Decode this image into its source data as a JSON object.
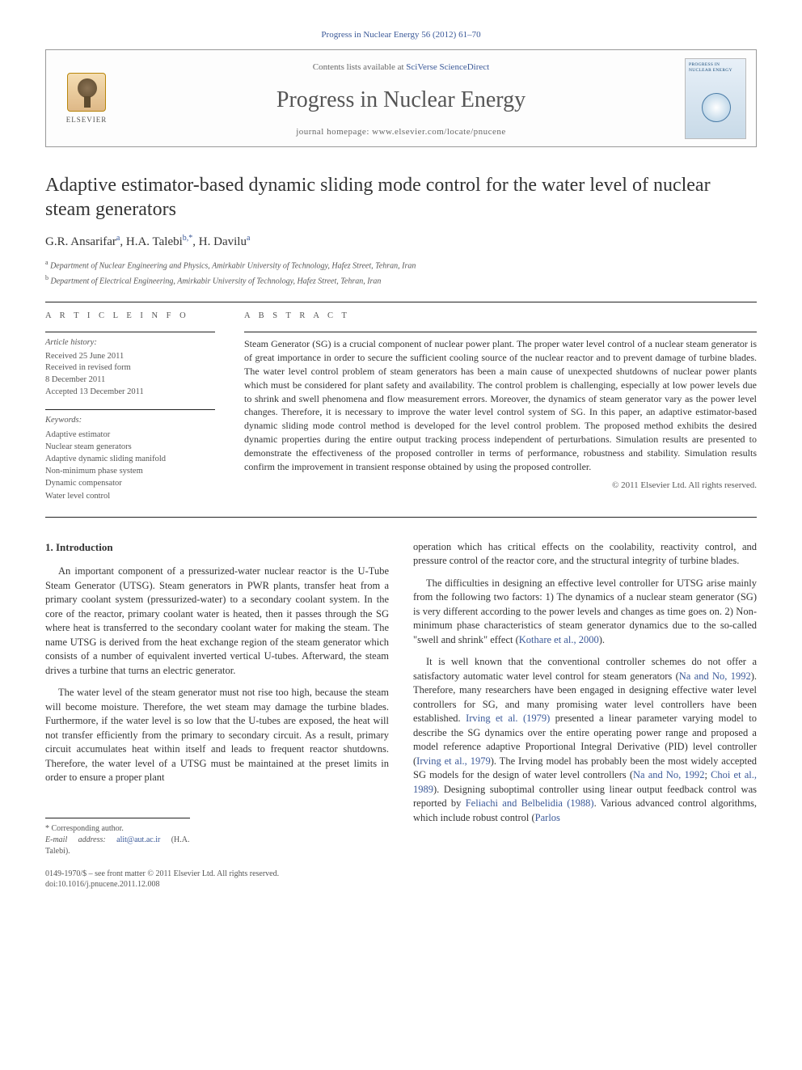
{
  "citation": "Progress in Nuclear Energy 56 (2012) 61–70",
  "header": {
    "contents_prefix": "Contents lists available at ",
    "contents_link": "SciVerse ScienceDirect",
    "journal": "Progress in Nuclear Energy",
    "homepage_prefix": "journal homepage: ",
    "homepage_url": "www.elsevier.com/locate/pnucene",
    "publisher": "ELSEVIER",
    "cover_caption": "PROGRESS IN NUCLEAR ENERGY"
  },
  "title": "Adaptive estimator-based dynamic sliding mode control for the water level of nuclear steam generators",
  "authors": [
    {
      "name": "G.R. Ansarifar",
      "affil": "a"
    },
    {
      "name": "H.A. Talebi",
      "affil": "b,*"
    },
    {
      "name": "H. Davilu",
      "affil": "a"
    }
  ],
  "affiliations": {
    "a": "Department of Nuclear Engineering and Physics, Amirkabir University of Technology, Hafez Street, Tehran, Iran",
    "b": "Department of Electrical Engineering, Amirkabir University of Technology, Hafez Street, Tehran, Iran"
  },
  "article_info_heading": "A R T I C L E   I N F O",
  "abstract_heading": "A B S T R A C T",
  "history": {
    "label": "Article history:",
    "items": [
      "Received 25 June 2011",
      "Received in revised form",
      "8 December 2011",
      "Accepted 13 December 2011"
    ]
  },
  "keywords": {
    "label": "Keywords:",
    "items": [
      "Adaptive estimator",
      "Nuclear steam generators",
      "Adaptive dynamic sliding manifold",
      "Non-minimum phase system",
      "Dynamic compensator",
      "Water level control"
    ]
  },
  "abstract": "Steam Generator (SG) is a crucial component of nuclear power plant. The proper water level control of a nuclear steam generator is of great importance in order to secure the sufficient cooling source of the nuclear reactor and to prevent damage of turbine blades. The water level control problem of steam generators has been a main cause of unexpected shutdowns of nuclear power plants which must be considered for plant safety and availability. The control problem is challenging, especially at low power levels due to shrink and swell phenomena and flow measurement errors. Moreover, the dynamics of steam generator vary as the power level changes. Therefore, it is necessary to improve the water level control system of SG. In this paper, an adaptive estimator-based dynamic sliding mode control method is developed for the level control problem. The proposed method exhibits the desired dynamic properties during the entire output tracking process independent of perturbations. Simulation results are presented to demonstrate the effectiveness of the proposed controller in terms of performance, robustness and stability. Simulation results confirm the improvement in transient response obtained by using the proposed controller.",
  "copyright": "© 2011 Elsevier Ltd. All rights reserved.",
  "section1": {
    "heading": "1. Introduction",
    "p1": "An important component of a pressurized-water nuclear reactor is the U-Tube Steam Generator (UTSG). Steam generators in PWR plants, transfer heat from a primary coolant system (pressurized-water) to a secondary coolant system. In the core of the reactor, primary coolant water is heated, then it passes through the SG where heat is transferred to the secondary coolant water for making the steam. The name UTSG is derived from the heat exchange region of the steam generator which consists of a number of equivalent inverted vertical U-tubes. Afterward, the steam drives a turbine that turns an electric generator.",
    "p2": "The water level of the steam generator must not rise too high, because the steam will become moisture. Therefore, the wet steam may damage the turbine blades. Furthermore, if the water level is so low that the U-tubes are exposed, the heat will not transfer efficiently from the primary to secondary circuit. As a result, primary circuit accumulates heat within itself and leads to frequent reactor shutdowns. Therefore, the water level of a UTSG must be maintained at the preset limits in order to ensure a proper plant",
    "p3_a": "operation which has critical effects on the coolability, reactivity control, and pressure control of the reactor core, and the structural integrity of turbine blades.",
    "p4_a": "The difficulties in designing an effective level controller for UTSG arise mainly from the following two factors: 1) The dynamics of a nuclear steam generator (SG) is very different according to the power levels and changes as time goes on. 2) Non-minimum phase characteristics of steam generator dynamics due to the so-called \"swell and shrink\" effect (",
    "p4_cite1": "Kothare et al., 2000",
    "p4_b": ").",
    "p5_a": "It is well known that the conventional controller schemes do not offer a satisfactory automatic water level control for steam generators (",
    "p5_cite1": "Na and No, 1992",
    "p5_b": "). Therefore, many researchers have been engaged in designing effective water level controllers for SG, and many promising water level controllers have been established. ",
    "p5_cite2": "Irving et al. (1979)",
    "p5_c": " presented a linear parameter varying model to describe the SG dynamics over the entire operating power range and proposed a model reference adaptive Proportional Integral Derivative (PID) level controller (",
    "p5_cite3": "Irving et al., 1979",
    "p5_d": "). The Irving model has probably been the most widely accepted SG models for the design of water level controllers (",
    "p5_cite4": "Na and No, 1992",
    "p5_e": "; ",
    "p5_cite5": "Choi et al., 1989",
    "p5_f": "). Designing suboptimal controller using linear output feedback control was reported by ",
    "p5_cite6": "Feliachi and Belbelidia (1988)",
    "p5_g": ". Various advanced control algorithms, which include robust control (",
    "p5_cite7": "Parlos"
  },
  "footnotes": {
    "corr": "* Corresponding author.",
    "email_label": "E-mail address: ",
    "email": "alit@aut.ac.ir",
    "email_name": " (H.A. Talebi)."
  },
  "bottom": {
    "line1": "0149-1970/$ – see front matter © 2011 Elsevier Ltd. All rights reserved.",
    "line2": "doi:10.1016/j.pnucene.2011.12.008"
  }
}
